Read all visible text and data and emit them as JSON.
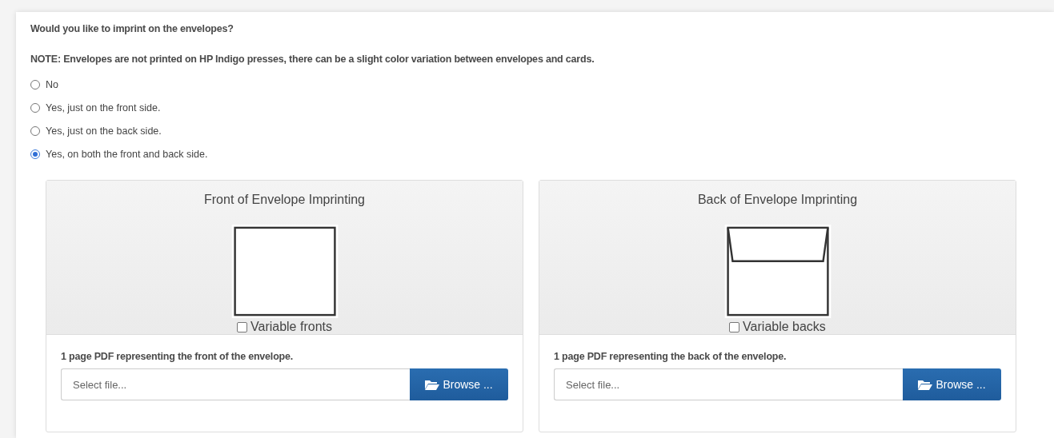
{
  "question": "Would you like to imprint on the envelopes?",
  "note": "NOTE: Envelopes are not printed on HP Indigo presses, there can be a slight color variation between envelopes and cards.",
  "options": [
    {
      "label": "No",
      "selected": false
    },
    {
      "label": "Yes, just on the front side.",
      "selected": false
    },
    {
      "label": "Yes, just on the back side.",
      "selected": false
    },
    {
      "label": "Yes, on both the front and back side.",
      "selected": true
    }
  ],
  "panels": [
    {
      "title": "Front of Envelope Imprinting",
      "kind": "front",
      "checkbox": {
        "label": "Variable fronts",
        "checked": false
      },
      "file_label": "1 page PDF representing the front of the envelope.",
      "file_placeholder": "Select file...",
      "button": "Browse ..."
    },
    {
      "title": "Back of Envelope Imprinting",
      "kind": "back",
      "checkbox": {
        "label": "Variable backs",
        "checked": false
      },
      "file_label": "1 page PDF representing the back of the envelope.",
      "file_placeholder": "Select file...",
      "button": "Browse ..."
    }
  ]
}
